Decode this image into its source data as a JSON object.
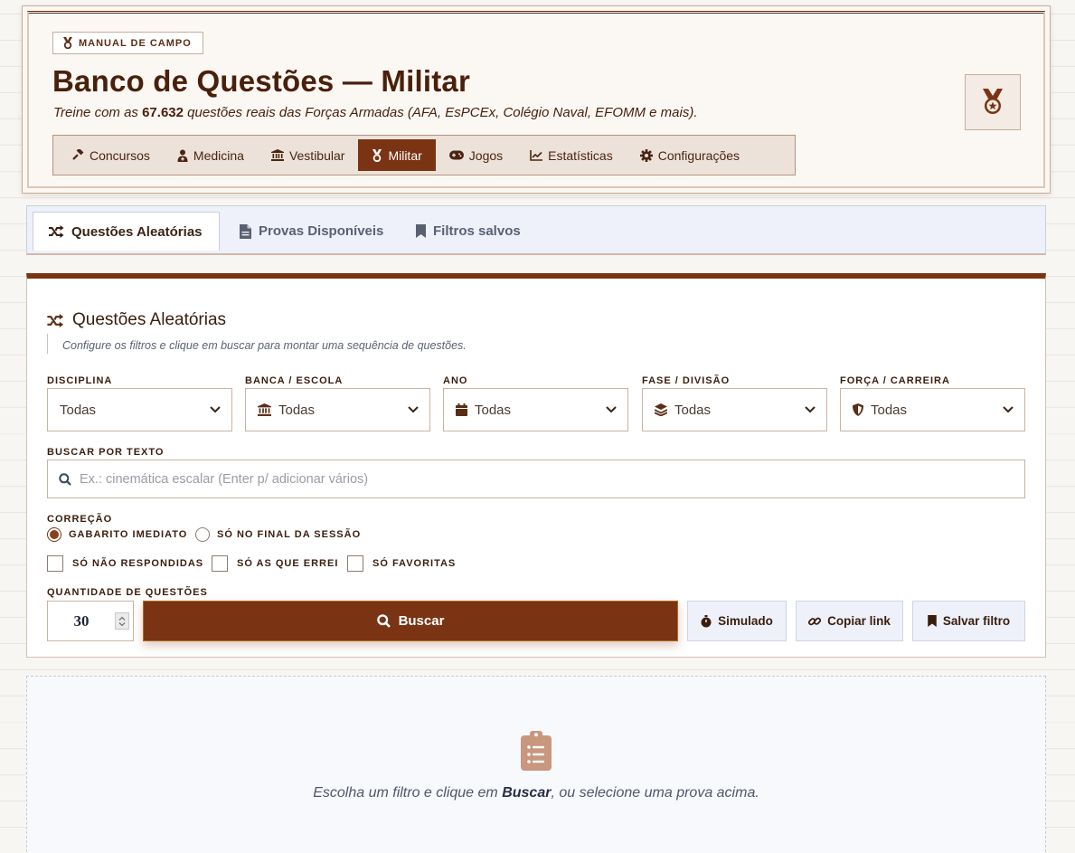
{
  "header": {
    "badge": "MANUAL DE CAMPO",
    "title": "Banco de Questões — Militar",
    "subtitle_prefix": "Treine com as",
    "subtitle_count": "67.632",
    "subtitle_suffix": "questões reais das Forças Armadas (AFA, EsPCEx, Colégio Naval, EFOMM e mais).",
    "emblem_icon": "medal-icon"
  },
  "nav": {
    "items": [
      {
        "label": "Concursos",
        "icon": "gavel-icon"
      },
      {
        "label": "Medicina",
        "icon": "doctor-icon"
      },
      {
        "label": "Vestibular",
        "icon": "building-columns-icon"
      },
      {
        "label": "Militar",
        "icon": "medal-icon",
        "active": true
      },
      {
        "label": "Jogos",
        "icon": "gamepad-icon"
      },
      {
        "label": "Estatísticas",
        "icon": "chart-line-icon"
      },
      {
        "label": "Configurações",
        "icon": "gear-icon"
      }
    ]
  },
  "tabs": [
    {
      "label": "Questões Aleatórias",
      "icon": "shuffle-icon",
      "active": true
    },
    {
      "label": "Provas Disponíveis",
      "icon": "file-icon"
    },
    {
      "label": "Filtros salvos",
      "icon": "bookmark-icon"
    }
  ],
  "panel": {
    "title": "Questões Aleatórias",
    "hint": "Configure os filtros e clique em buscar para montar uma sequência de questões.",
    "filters": [
      {
        "label": "DISCIPLINA",
        "value": "Todas",
        "icon": ""
      },
      {
        "label": "BANCA / ESCOLA",
        "value": "Todas",
        "icon": "building-columns-icon"
      },
      {
        "label": "ANO",
        "value": "Todas",
        "icon": "calendar-icon"
      },
      {
        "label": "FASE / DIVISÃO",
        "value": "Todas",
        "icon": "layers-icon"
      },
      {
        "label": "FORÇA / CARREIRA",
        "value": "Todas",
        "icon": "shield-icon"
      }
    ],
    "search": {
      "label": "BUSCAR POR TEXTO",
      "placeholder": "Ex.: cinemática escalar (Enter p/ adicionar vários)"
    },
    "correction": {
      "label": "CORREÇÃO",
      "options": [
        {
          "label": "GABARITO IMEDIATO",
          "selected": true
        },
        {
          "label": "SÓ NO FINAL DA SESSÃO",
          "selected": false
        }
      ]
    },
    "checks": [
      {
        "label": "SÓ NÃO RESPONDIDAS",
        "checked": false
      },
      {
        "label": "SÓ AS QUE ERREI",
        "checked": false
      },
      {
        "label": "SÓ FAVORITAS",
        "checked": false
      }
    ],
    "quantity": {
      "label": "QUANTIDADE DE QUESTÕES",
      "value": "30"
    },
    "buttons": {
      "search": "Buscar",
      "simulado": "Simulado",
      "copy_link": "Copiar link",
      "save_filter": "Salvar filtro"
    }
  },
  "empty_state": {
    "prefix": "Escolha um filtro e clique em",
    "emph": "Buscar",
    "suffix": ", ou selecione uma prova acima.",
    "icon": "clipboard-list-icon"
  },
  "colors": {
    "accent": "#7a3413",
    "accent_border": "#b26a20",
    "title": "#4a200b",
    "tab_bg": "#eef1fa"
  }
}
